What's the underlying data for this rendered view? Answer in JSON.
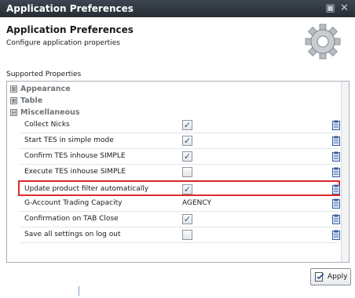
{
  "window": {
    "title": "Application Preferences",
    "icons": [
      "restore-icon",
      "close-icon"
    ]
  },
  "header": {
    "title": "Application Preferences",
    "subtitle": "Configure application properties",
    "icon": "gear-icon"
  },
  "section_label": "Supported Properties",
  "groups": [
    {
      "label": "Appearance",
      "expanded": false,
      "expander": "⊞"
    },
    {
      "label": "Table",
      "expanded": false,
      "expander": "⊞"
    },
    {
      "label": "Miscellaneous",
      "expanded": true,
      "expander": "⊟"
    }
  ],
  "properties": [
    {
      "label": "Collect Nicks",
      "type": "checkbox",
      "checked": true,
      "mark": "✓"
    },
    {
      "label": "Start TES in simple mode",
      "type": "checkbox",
      "checked": true,
      "mark": "✓"
    },
    {
      "label": "Confirm TES inhouse SIMPLE",
      "type": "checkbox",
      "checked": true,
      "mark": "✓"
    },
    {
      "label": "Execute TES inhouse SIMPLE",
      "type": "checkbox",
      "checked": false,
      "mark": ""
    },
    {
      "label": "Update product filter automatically",
      "type": "checkbox",
      "checked": true,
      "mark": "✓",
      "highlighted": true
    },
    {
      "label": "G-Account Trading Capacity",
      "type": "text",
      "value": "AGENCY"
    },
    {
      "label": "Confirmation on TAB Close",
      "type": "checkbox",
      "checked": true,
      "mark": "✓"
    },
    {
      "label": "Save all settings on log out",
      "type": "checkbox",
      "checked": false,
      "mark": ""
    }
  ],
  "row_action_icon": "clipboard-edit-icon",
  "highlight_color": "#e02a2a",
  "buttons": {
    "apply": "Apply"
  }
}
